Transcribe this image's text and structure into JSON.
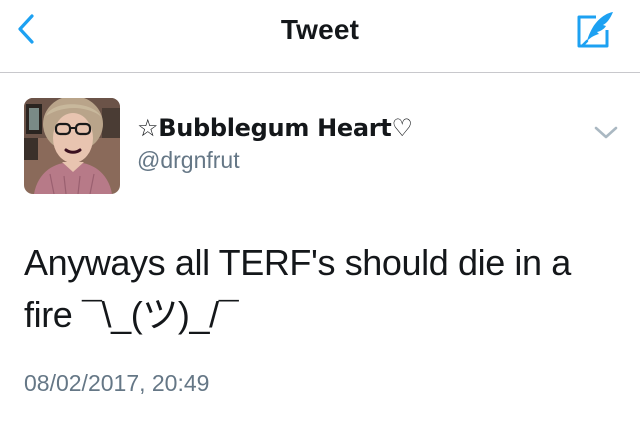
{
  "nav": {
    "title": "Tweet",
    "back_icon": "chevron-left-icon",
    "compose_icon": "compose-quill-icon",
    "accent": "#1da1f2"
  },
  "tweet": {
    "display_name": "☆Bubblegum Heart♡",
    "handle": "@drgnfrut",
    "text": "Anyways all TERF's should die in a fire ¯\\_(ツ)_/¯",
    "timestamp": "08/02/2017, 20:49",
    "menu_icon": "chevron-down-icon"
  },
  "colors": {
    "primary_text": "#14171a",
    "secondary_text": "#657786",
    "divider": "#c8c8cc"
  }
}
